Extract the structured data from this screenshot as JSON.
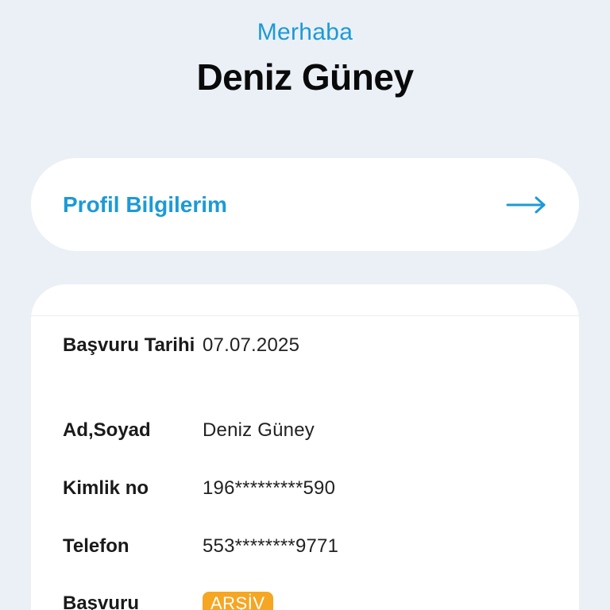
{
  "header": {
    "greeting": "Merhaba",
    "user_name": "Deniz Güney"
  },
  "profile_card": {
    "label": "Profil Bilgilerim",
    "icon": "arrow-right-icon"
  },
  "application": {
    "rows": [
      {
        "label": "Başvuru Tarihi",
        "value": "07.07.2025"
      },
      {
        "label": "Ad,Soyad",
        "value": "Deniz Güney"
      },
      {
        "label": "Kimlik no",
        "value": "196*********590"
      },
      {
        "label": "Telefon",
        "value": "553********9771"
      },
      {
        "label": "Başvuru",
        "value": "ARŞİV"
      }
    ]
  },
  "colors": {
    "accent": "#1c9ad6",
    "background": "#ebf0f7",
    "card": "#ffffff",
    "status_badge": "#f5a623"
  }
}
